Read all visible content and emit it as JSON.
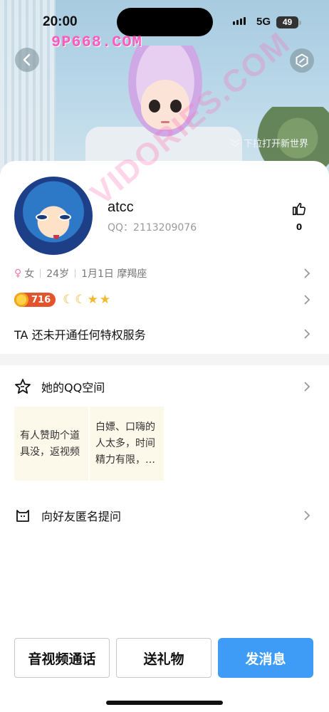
{
  "status_bar": {
    "time": "20:00",
    "network": "5G",
    "battery": "49"
  },
  "header": {
    "watermark": "9P668.COM",
    "pull_hint": "下拉打开新世界",
    "icons": {
      "back": "chevron-left-icon",
      "settings": "hexagon-settings-icon",
      "pull": "double-chevron-down-icon"
    }
  },
  "profile": {
    "nickname": "atcc",
    "qq_number": "QQ：2113209076",
    "likes": "0",
    "gender": "女",
    "age": "24岁",
    "birthday": "1月1日 摩羯座",
    "level": "716",
    "level_icons": [
      "moon",
      "moon",
      "star",
      "star"
    ],
    "privilege": "TA 还未开通任何特权服务"
  },
  "qzone": {
    "title": "她的QQ空间",
    "posts": [
      {
        "text": "有人赞助个道具没，返视频"
      },
      {
        "text": "白嫖、口嗨的人太多，时间精力有限，…"
      }
    ]
  },
  "ask": {
    "title": "向好友匿名提问"
  },
  "actions": {
    "call": "音视频通话",
    "gift": "送礼物",
    "message": "发消息"
  },
  "overlay_watermark": "VIDORIES.COM",
  "colors": {
    "primary_button": "#3e9bf6",
    "level_badge": "#e3532c",
    "watermark": "#ff5bbf"
  }
}
